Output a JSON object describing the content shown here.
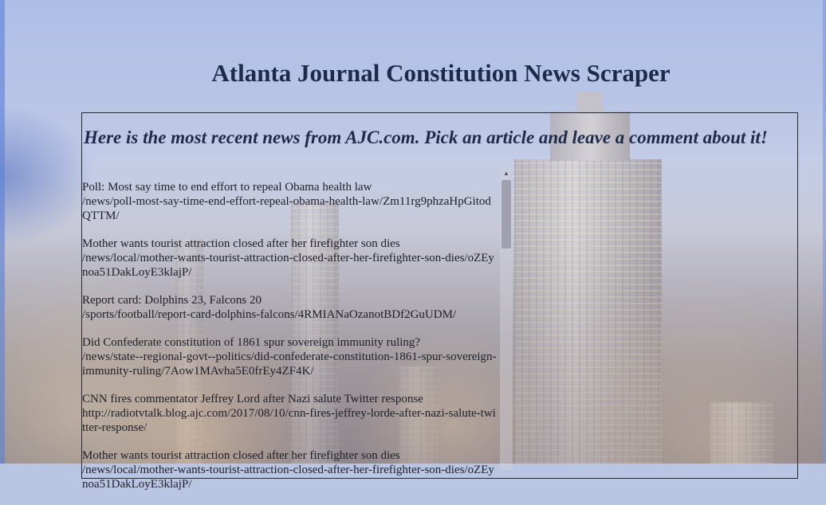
{
  "page": {
    "title": "Atlanta Journal Constitution News Scraper",
    "intro": "Here is the most recent news from AJC.com. Pick an article and leave a comment about it!"
  },
  "articles": [
    {
      "headline": "Poll: Most say time to end effort to repeal Obama health law",
      "path": "/news/poll-most-say-time-end-effort-repeal-obama-health-law/Zm11rg9phzaHpGitodQTTM/"
    },
    {
      "headline": "Mother wants tourist attraction closed after her firefighter son dies",
      "path": "/news/local/mother-wants-tourist-attraction-closed-after-her-firefighter-son-dies/oZEynoa51DakLoyE3klajP/"
    },
    {
      "headline": "Report card: Dolphins 23, Falcons 20",
      "path": "/sports/football/report-card-dolphins-falcons/4RMIANaOzanotBDf2GuUDM/"
    },
    {
      "headline": "Did Confederate constitution of 1861 spur sovereign immunity ruling?",
      "path": "/news/state--regional-govt--politics/did-confederate-constitution-1861-spur-sovereign-immunity-ruling/7Aow1MAvha5E0frEy4ZF4K/"
    },
    {
      "headline": "CNN fires commentator Jeffrey Lord after Nazi salute Twitter response",
      "path": "http://radiotvtalk.blog.ajc.com/2017/08/10/cnn-fires-jeffrey-lorde-after-nazi-salute-twitter-response/"
    },
    {
      "headline": "Mother wants tourist attraction closed after her firefighter son dies",
      "path": "/news/local/mother-wants-tourist-attraction-closed-after-her-firefighter-son-dies/oZEynoa51DakLoyE3klajP/"
    }
  ],
  "icons": {
    "scroll_up": "scroll-up-arrow-icon"
  }
}
